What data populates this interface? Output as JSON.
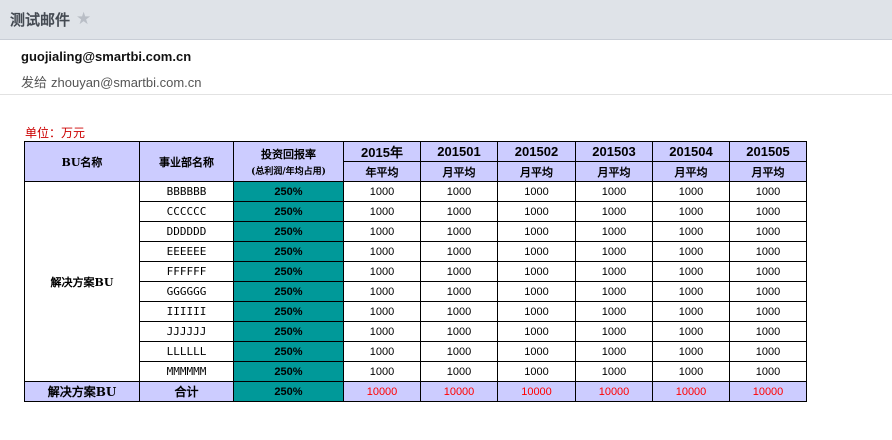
{
  "email": {
    "subject": "测试邮件",
    "star_icon": "star-icon",
    "sender": "guojialing@smartbi.com.cn",
    "to_label": "发给",
    "recipient": "zhouyan@smartbi.com.cn"
  },
  "report": {
    "unit_label": "单位：万元",
    "headers": {
      "bu": "BU名称",
      "dept": "事业部名称",
      "roi": "投资回报率",
      "roi_sub": "(总利润/年均占用)",
      "periods": [
        "2015年",
        "201501",
        "201502",
        "201503",
        "201504",
        "201505"
      ],
      "period_subs": [
        "年平均",
        "月平均",
        "月平均",
        "月平均",
        "月平均",
        "月平均"
      ]
    },
    "bu_name": "解决方案BU",
    "rows": [
      {
        "dept": "BBBBBB",
        "roi": "250%",
        "values": [
          "1000",
          "1000",
          "1000",
          "1000",
          "1000",
          "1000"
        ]
      },
      {
        "dept": "CCCCCC",
        "roi": "250%",
        "values": [
          "1000",
          "1000",
          "1000",
          "1000",
          "1000",
          "1000"
        ]
      },
      {
        "dept": "DDDDDD",
        "roi": "250%",
        "values": [
          "1000",
          "1000",
          "1000",
          "1000",
          "1000",
          "1000"
        ]
      },
      {
        "dept": "EEEEEE",
        "roi": "250%",
        "values": [
          "1000",
          "1000",
          "1000",
          "1000",
          "1000",
          "1000"
        ]
      },
      {
        "dept": "FFFFFF",
        "roi": "250%",
        "values": [
          "1000",
          "1000",
          "1000",
          "1000",
          "1000",
          "1000"
        ]
      },
      {
        "dept": "GGGGGG",
        "roi": "250%",
        "values": [
          "1000",
          "1000",
          "1000",
          "1000",
          "1000",
          "1000"
        ]
      },
      {
        "dept": "IIIIII",
        "roi": "250%",
        "values": [
          "1000",
          "1000",
          "1000",
          "1000",
          "1000",
          "1000"
        ]
      },
      {
        "dept": "JJJJJJ",
        "roi": "250%",
        "values": [
          "1000",
          "1000",
          "1000",
          "1000",
          "1000",
          "1000"
        ]
      },
      {
        "dept": "LLLLLL",
        "roi": "250%",
        "values": [
          "1000",
          "1000",
          "1000",
          "1000",
          "1000",
          "1000"
        ]
      },
      {
        "dept": "MMMMMM",
        "roi": "250%",
        "values": [
          "1000",
          "1000",
          "1000",
          "1000",
          "1000",
          "1000"
        ]
      }
    ],
    "total": {
      "bu": "解决方案BU",
      "label": "合计",
      "roi": "250%",
      "values": [
        "10000",
        "10000",
        "10000",
        "10000",
        "10000",
        "10000"
      ]
    },
    "colors": {
      "header_bg": "#ccccff",
      "roi_bg": "#009999",
      "total_text": "#ff0000",
      "unit_text": "#cc0000"
    }
  }
}
